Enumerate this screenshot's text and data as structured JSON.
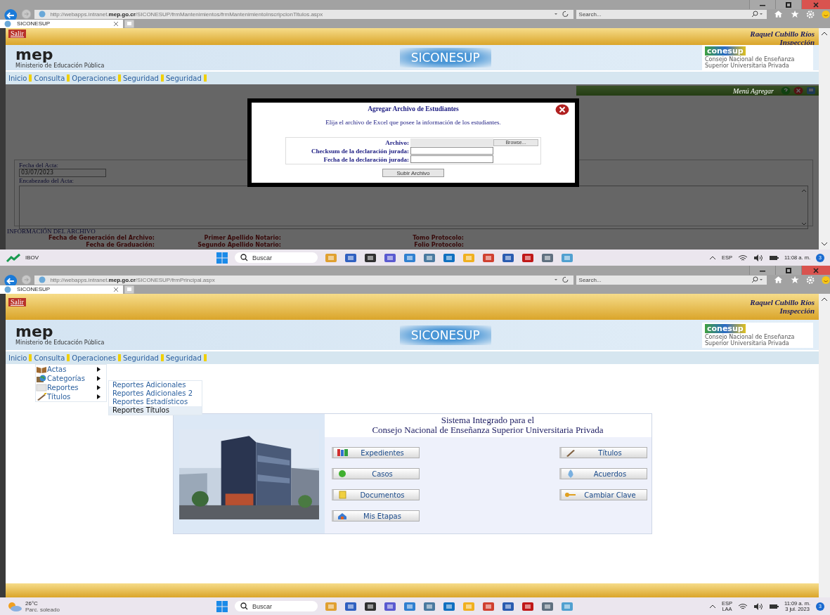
{
  "windows": [
    {
      "kind": "upload",
      "browser": {
        "url": "http://webapps.intranet.**mep.go.cr**/SICONESUP/frmMantenimientos/frmMantenimientoInscripcionTitulos.aspx",
        "search_placeholder": "Search...",
        "tab": "SICONESUP"
      },
      "header": {
        "logout": "Salir",
        "user": "Raquel Cubillo Ríos",
        "role": "Inspección",
        "logo": "mep",
        "logo_caption": "Ministerio de Educación Pública",
        "site_title": "SICONESUP",
        "partner_logo": "conesup",
        "partner_caption": "Consejo Nacional de Enseñanza Superior Universitaria Privada"
      },
      "menu": [
        "Inicio",
        "Consulta",
        "Operaciones",
        "Seguridad",
        "Seguridad"
      ],
      "action_bar": {
        "label": "Menú Agregar"
      },
      "acta": {
        "date_label": "Fecha del Acta:",
        "date": "03/07/2023",
        "header_label": "Encabezado del Acta:"
      },
      "file_info": {
        "title": "INFORMACIÓN DEL ARCHIVO",
        "rows": [
          [
            "Fecha de Generación del Archivo:",
            "Primer Apellido Notario:",
            "Tomo Protocolo:"
          ],
          [
            "Fecha de Graduación:",
            "Segundo Apellido Notario:",
            "Folio Protocolo:"
          ]
        ]
      },
      "dialog": {
        "title": "Agregar Archivo de Estudiantes",
        "instruction": "Elija el archivo de Excel que posee la información de los estudiantes.",
        "fields": [
          {
            "kind": "file",
            "label": "Archivo:",
            "button": "Browse..."
          },
          {
            "kind": "text",
            "label": "Checksum de la declaración jurada:"
          },
          {
            "kind": "text",
            "label": "Fecha de la declaración jurada:"
          }
        ],
        "submit": "Subir Archivo"
      },
      "taskbar": {
        "widget": {
          "kind": "stock",
          "title": "IBOV"
        },
        "search": "Buscar",
        "lang": "ESP",
        "time": "11:08 a. m.",
        "badge": "3"
      }
    },
    {
      "kind": "home",
      "browser": {
        "url": "http://webapps.intranet.**mep.go.cr**/SICONESUP/frmPrincipal.aspx",
        "search_placeholder": "Search...",
        "tab": "SICONESUP"
      },
      "header": {
        "logout": "Salir",
        "user": "Raquel Cubillo Ríos",
        "role": "Inspección",
        "logo": "mep",
        "logo_caption": "Ministerio de Educación Pública",
        "site_title": "SICONESUP",
        "partner_logo": "conesup",
        "partner_caption": "Consejo Nacional de Enseñanza Superior Universitaria Privada"
      },
      "menu": [
        "Inicio",
        "Consulta",
        "Operaciones",
        "Seguridad",
        "Seguridad"
      ],
      "dropdown": [
        {
          "label": "Actas"
        },
        {
          "label": "Categorías"
        },
        {
          "label": "Reportes",
          "children": [
            {
              "label": "Reportes Adicionales",
              "selected": false
            },
            {
              "label": "Reportes Adicionales 2",
              "selected": false
            },
            {
              "label": "Reportes Estadísticos",
              "selected": false
            },
            {
              "label": "Reportes Títulos",
              "selected": true
            }
          ]
        },
        {
          "label": "Títulos"
        }
      ],
      "panel": {
        "title": [
          "Sistema Integrado para el",
          "Consejo Nacional de Enseñanza Superior Universitaria Privada"
        ],
        "buttons_left": [
          "Expedientes",
          "Casos",
          "Documentos",
          "Mis Etapas"
        ],
        "buttons_right": [
          "Títulos",
          "Acuerdos",
          "Cambiar Clave"
        ]
      },
      "taskbar": {
        "widget": {
          "kind": "weather",
          "title": "26°C",
          "subtitle": "Parc. soleado"
        },
        "search": "Buscar",
        "lang": "ESP",
        "lang_sub": "LAA",
        "time": "11:09 a. m.",
        "date": "3 jul. 2023",
        "badge": "3"
      }
    }
  ]
}
